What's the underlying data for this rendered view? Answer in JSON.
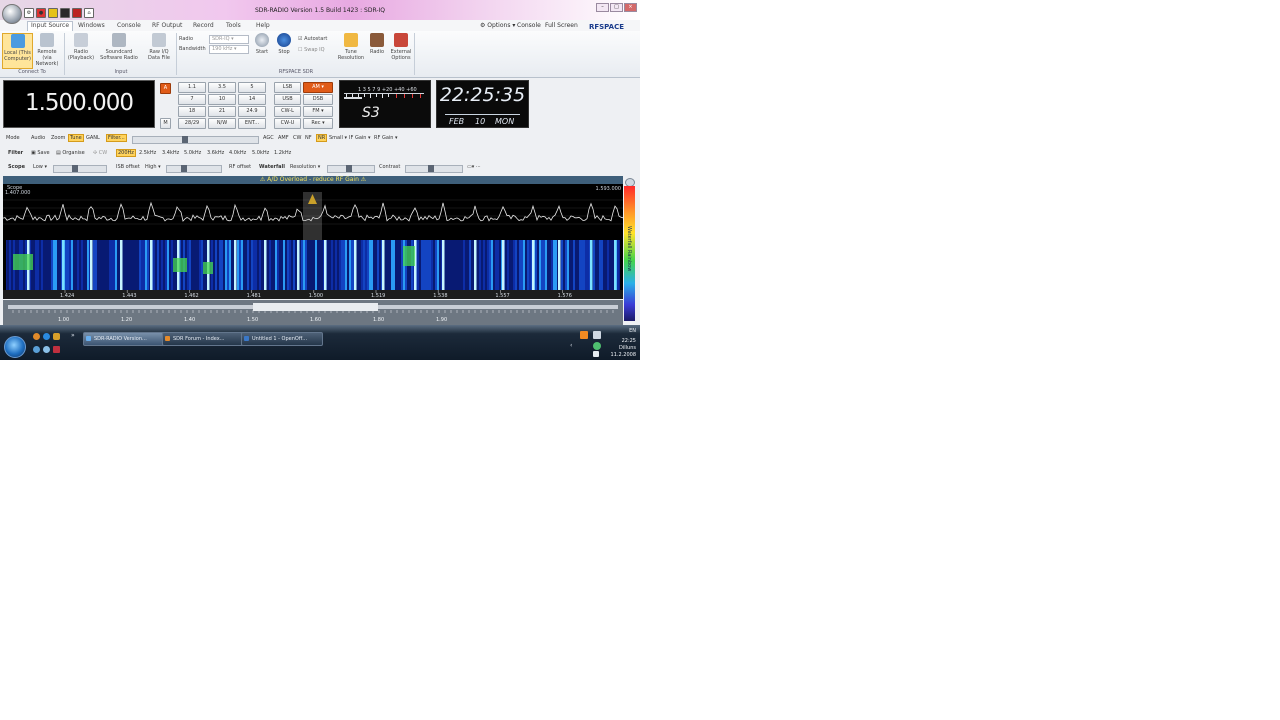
{
  "window": {
    "title": "SDR-RADIO Version 1.5 Build 1423 : SDR-IQ",
    "controls": [
      "–",
      "□",
      "×"
    ]
  },
  "ribbon": {
    "tabs": [
      "Input Source",
      "Windows",
      "Console",
      "RF Output",
      "Record",
      "Tools",
      "Help"
    ],
    "right_options": "Options",
    "right_console": "Console",
    "right_fullscreen": "Full Screen",
    "brand": "RFSPACE",
    "buttons": {
      "local": "Local (This Computer)",
      "remote": "Remote (via Network)",
      "radio": "Radio (Playback)",
      "soundcard": "Soundcard Software Radio",
      "rawiq": "Raw I/Q Data File"
    },
    "radio_label": "Radio",
    "radio_value": "SDR-IQ",
    "bandwidth_label": "Bandwidth",
    "bandwidth_value": "190 kHz",
    "start": "Start",
    "stop": "Stop",
    "autostart": "Autostart",
    "swapiq": "Swap IQ",
    "tune_resolution": "Tune Resolution",
    "external_options": "External Options",
    "external_radio": "Radio",
    "groups": {
      "connect": "Connect To",
      "input": "Input",
      "rfspace": "RFSPACE SDR"
    }
  },
  "frequency": {
    "display": "1.500.000",
    "keys": [
      "1.1",
      "3.5",
      "5",
      "7",
      "10",
      "14",
      "18",
      "21",
      "24.9",
      "28/29",
      "N/W",
      "ENT..."
    ],
    "a_label": "A",
    "m_label": "M",
    "modes": [
      "LSB",
      "AM",
      "USB",
      "DSB",
      "CW-L",
      "FM",
      "CW-U",
      "Rec"
    ]
  },
  "smeter": {
    "value": "S3",
    "scale": "1 3 5 7 9 +20 +40 +60"
  },
  "clock": {
    "time": "22:25:35",
    "month": "FEB",
    "day": "10",
    "weekday": "MON"
  },
  "row1": {
    "mode": "Mode",
    "audio": "Audio",
    "zoom": "Zoom",
    "tune": "Tune",
    "ganl": "GANL",
    "filter": "Filter...",
    "agc": "AGC",
    "amf": "AMF",
    "cw": "CW",
    "nf": "NF",
    "nr": "NR",
    "small": "Small",
    "if_gain": "IF Gain",
    "rf_gain": "RF Gain"
  },
  "row2": {
    "filter": "Filter",
    "save": "Save",
    "organise": "Organise",
    "cw": "CW",
    "presets": [
      "200Hz",
      "2.5kHz",
      "3.4kHz",
      "5.0kHz",
      "3.6kHz",
      "4.0kHz",
      "5.0kHz",
      "1.2kHz"
    ]
  },
  "row3": {
    "scope": "Scope",
    "low": "Low",
    "if_offset": "ISB offset",
    "high": "High",
    "rf_offset": "RF offset",
    "waterfall": "Waterfall",
    "resolution": "Resolution",
    "contrast": "Contrast"
  },
  "spectrum": {
    "warning": "A/D Overload - reduce RF Gain",
    "left_top": "1.407.000",
    "right_top": "1.593.000",
    "scope_label": "Scope",
    "freq_ticks": [
      "1.424",
      "1.443",
      "1.462",
      "1.481",
      "1.500",
      "1.519",
      "1.538",
      "1.557",
      "1.576"
    ],
    "tuner_ticks": [
      "1.00",
      "1.20",
      "1.40",
      "1.50",
      "1.60",
      "1.80",
      "1.90"
    ],
    "colorbar_label": "Waterfall Rainbow"
  },
  "taskbar": {
    "items": [
      "SDR-RADIO Version...",
      "SDR Forum - Index...",
      "Untitled 1 - OpenOff..."
    ],
    "lang": "EN",
    "time": "22:25",
    "day": "Dilluns",
    "date": "11.2.2008"
  }
}
